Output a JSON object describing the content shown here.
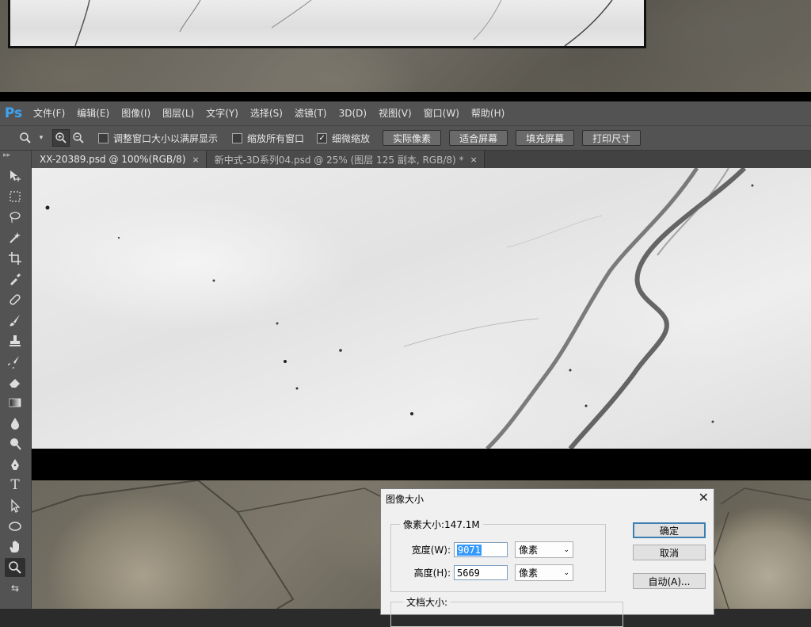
{
  "app": {
    "logo": "Ps"
  },
  "menu": [
    "文件(F)",
    "编辑(E)",
    "图像(I)",
    "图层(L)",
    "文字(Y)",
    "选择(S)",
    "滤镜(T)",
    "3D(D)",
    "视图(V)",
    "窗口(W)",
    "帮助(H)"
  ],
  "options": {
    "checkboxes": [
      {
        "label": "调整窗口大小以满屏显示",
        "checked": false
      },
      {
        "label": "缩放所有窗口",
        "checked": false
      },
      {
        "label": "细微缩放",
        "checked": true
      }
    ],
    "buttons": [
      "实际像素",
      "适合屏幕",
      "填充屏幕",
      "打印尺寸"
    ]
  },
  "tabs": [
    {
      "label": "XX-20389.psd @ 100%(RGB/8)",
      "close": "×",
      "active": true
    },
    {
      "label": "新中式-3D系列04.psd @ 25% (图层 125 副本, RGB/8) *",
      "close": "×",
      "active": false
    }
  ],
  "tools": [
    "move-tool-icon",
    "marquee-tool-icon",
    "lasso-tool-icon",
    "magic-wand-icon",
    "crop-tool-icon",
    "eyedropper-icon",
    "healing-brush-icon",
    "brush-tool-icon",
    "clone-stamp-icon",
    "history-brush-icon",
    "eraser-icon",
    "gradient-tool-icon",
    "blur-tool-icon",
    "dodge-tool-icon",
    "pen-tool-icon",
    "type-tool-icon",
    "path-select-icon",
    "ellipse-tool-icon",
    "hand-tool-icon",
    "zoom-tool-icon"
  ],
  "dialog": {
    "title": "图像大小",
    "close": "✕",
    "pixel_size_label": "像素大小:147.1M",
    "width_label": "宽度(W):",
    "width_value": "9071",
    "height_label": "高度(H):",
    "height_value": "5669",
    "unit": "像素",
    "doc_size_label": "文档大小:",
    "ok": "确定",
    "cancel": "取消",
    "auto": "自动(A)..."
  }
}
